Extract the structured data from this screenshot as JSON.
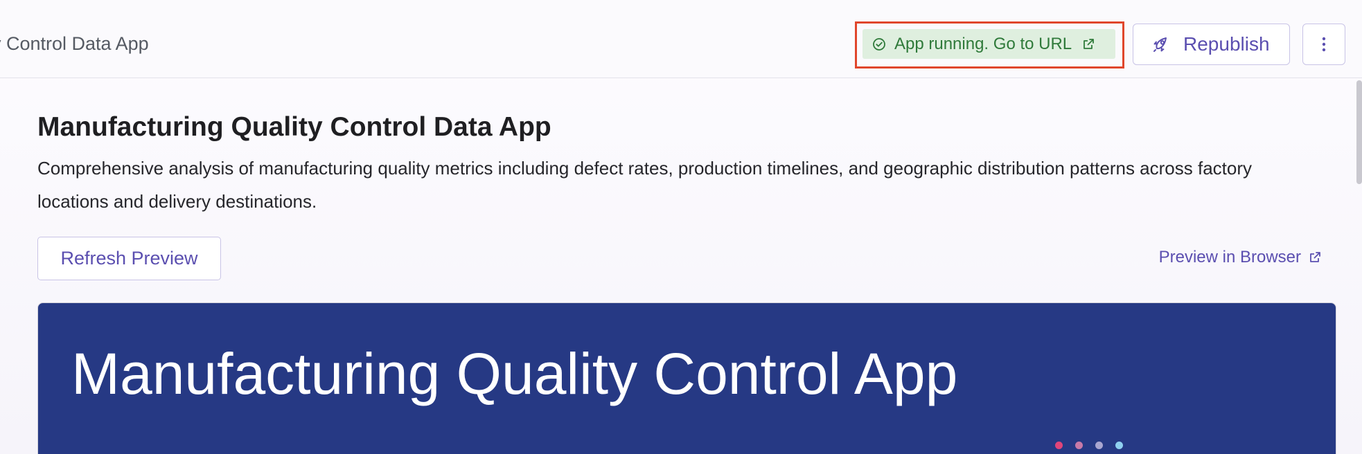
{
  "header": {
    "app_name_fragment": "y Control Data App",
    "status": {
      "text": "App running. Go to URL",
      "icon": "check-circle-icon",
      "link_icon": "external-link-icon",
      "color": "#2f7a3a",
      "background": "#dfefdf",
      "highlight_color": "#e0462c"
    },
    "republish_label": "Republish",
    "republish_icon": "rocket-icon",
    "more_icon": "more-vertical-icon"
  },
  "content": {
    "title": "Manufacturing Quality Control Data App",
    "description": "Comprehensive analysis of manufacturing quality metrics including defect rates, production timelines, and geographic distribution patterns across factory locations and delivery destinations.",
    "refresh_label": "Refresh Preview",
    "preview_link_label": "Preview in Browser"
  },
  "preview": {
    "hero_title": "Manufacturing Quality Control App",
    "background": "#263984",
    "logo_dot_colors": [
      "#e0457a",
      "#c87aa8",
      "#a9a6d0",
      "#8fd0f0"
    ]
  },
  "colors": {
    "accent": "#5b4fb0"
  }
}
